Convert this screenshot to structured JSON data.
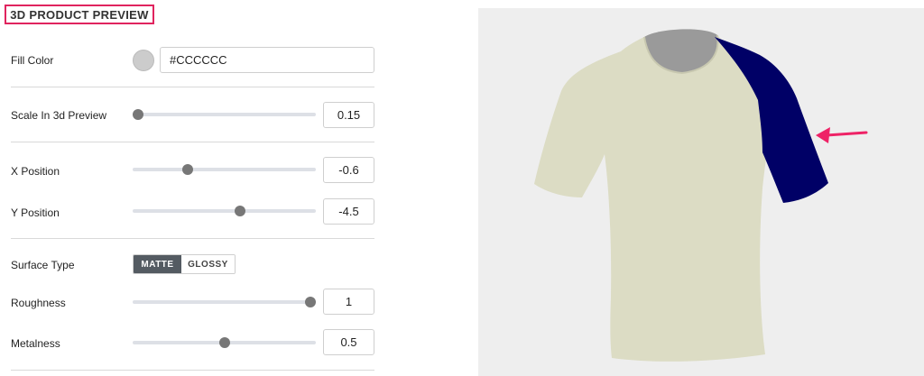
{
  "header": {
    "title": "3D PRODUCT PREVIEW"
  },
  "fill_color": {
    "label": "Fill Color",
    "value": "#CCCCCC",
    "swatch_color": "#CCCCCC"
  },
  "scale": {
    "label": "Scale In 3d Preview",
    "value": "0.15",
    "fraction": 0.0
  },
  "x_position": {
    "label": "X Position",
    "value": "-0.6",
    "fraction": 0.29
  },
  "y_position": {
    "label": "Y Position",
    "value": "-4.5",
    "fraction": 0.59
  },
  "surface_type": {
    "label": "Surface Type",
    "options": [
      "MATTE",
      "GLOSSY"
    ],
    "selected": "MATTE"
  },
  "roughness": {
    "label": "Roughness",
    "value": "1",
    "fraction": 1.0
  },
  "metalness": {
    "label": "Metalness",
    "value": "0.5",
    "fraction": 0.5
  },
  "preview": {
    "shirt_body_color": "#dcdcc4",
    "collar_inner_color": "#9a9a9a",
    "sleeve_highlight_color": "#000066",
    "arrow_color": "#ee2266",
    "background_color": "#eeeeee"
  }
}
